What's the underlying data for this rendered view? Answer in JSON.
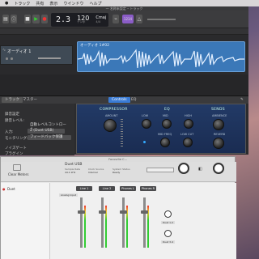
{
  "menubar": {
    "items": [
      "トラック",
      "共有",
      "表示",
      "ウインドウ",
      "ヘルプ"
    ]
  },
  "garageband": {
    "window_title": "一 名称未設定 – トラック",
    "lcd": {
      "position": "2.3",
      "tempo": "120",
      "tempo_label": "テンポ",
      "key": "Cmaj",
      "time_sig": "4/4",
      "sub_label": "キー"
    },
    "count_in_badge": "1234",
    "track_name": "オーディオ 1",
    "region_label": "オーディオ 1#02",
    "smart_tabs": {
      "track": "トラック",
      "master": "マスター",
      "controls": "Controls",
      "eq": "EQ"
    },
    "panel_left": {
      "section": "録音設定",
      "level_label": "録音レベル:",
      "level_value": "自動レベルコントロール",
      "input_label": "入力:",
      "input_value": "2 (Duet USB)",
      "monitor_label": "モニタリング:",
      "monitor_value": "フィードバック保護",
      "noise_gate": "ノイズゲート",
      "plugins": "プラグイン"
    },
    "amp": {
      "compressor": "COMPRESSOR",
      "eq": "EQ",
      "sends": "SENDS",
      "knobs": [
        "AMOUNT",
        "LOW",
        "MID",
        "HIGH",
        "AMBIENCE",
        "MID FREQ",
        "LOW CUT",
        "REVERB"
      ]
    }
  },
  "focusrite": {
    "window_title": "Focusrite C...",
    "clear_meters": "Clear Meters",
    "device_name": "Duet USB",
    "sample_rate_label": "Sample Rate",
    "sample_rate_value": "44.1 kHz",
    "clock_label": "Clock Source",
    "clock_value": "Internal",
    "status_label": "System Status",
    "status_value": "Ready",
    "input_name": "Duet",
    "input_badge": "Analog Input",
    "channel_headers": [
      "Line 1",
      "Line 2",
      "Phones L",
      "Phones R"
    ],
    "knob_labels": [
      "Duet 1-2",
      "Duet 3-4"
    ]
  }
}
